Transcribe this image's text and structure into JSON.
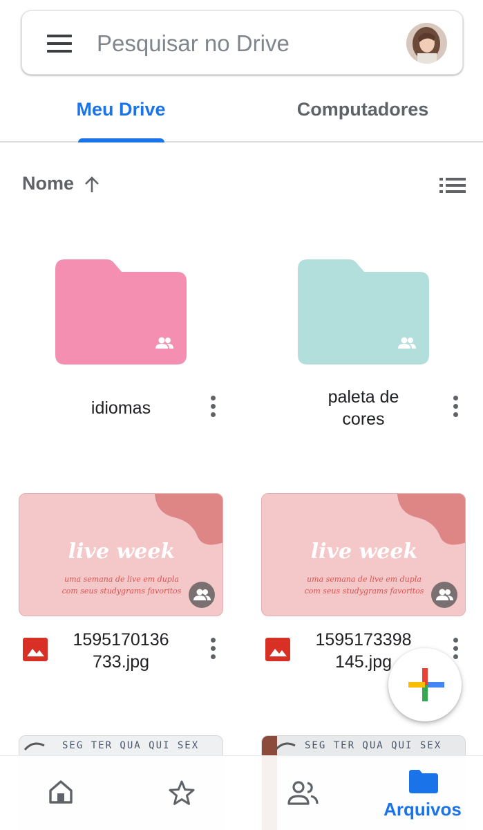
{
  "search": {
    "placeholder": "Pesquisar no Drive"
  },
  "tabs": [
    {
      "label": "Meu Drive",
      "selected": true
    },
    {
      "label": "Computadores",
      "selected": false
    }
  ],
  "sort": {
    "label": "Nome",
    "direction": "ascending",
    "view_icon": "list-view-icon"
  },
  "folders": [
    {
      "name": "idiomas",
      "color": "#f48fb1",
      "shared": true
    },
    {
      "name_line1": "paleta de",
      "name_line2": "cores",
      "color": "#b2dfdb",
      "shared": true
    }
  ],
  "files": [
    {
      "name_line1": "1595170136",
      "name_line2": "733.jpg",
      "thumb_title": "live week",
      "thumb_line1": "uma semana de live em dupla",
      "thumb_line2": "com seus studygrams favoritos",
      "shared": true
    },
    {
      "name_line1": "1595173398",
      "name_line2": "145.jpg",
      "thumb_title": "live week",
      "thumb_line1": "uma semana de live em dupla",
      "thumb_line2": "com seus studygrams favoritos",
      "shared": true
    }
  ],
  "notebook_preview": {
    "days": "SEG TER QUA QUI SEX"
  },
  "bottom_nav": [
    {
      "icon": "home-icon",
      "label": ""
    },
    {
      "icon": "star-icon",
      "label": ""
    },
    {
      "icon": "shared-people-icon",
      "label": ""
    },
    {
      "icon": "folder-icon",
      "label": "Arquivos",
      "selected": true
    }
  ],
  "colors": {
    "accent": "#1a73e8",
    "fab_red": "#ea4335",
    "fab_blue": "#4285f4",
    "fab_yellow": "#fbbc04",
    "fab_green": "#34a853"
  }
}
